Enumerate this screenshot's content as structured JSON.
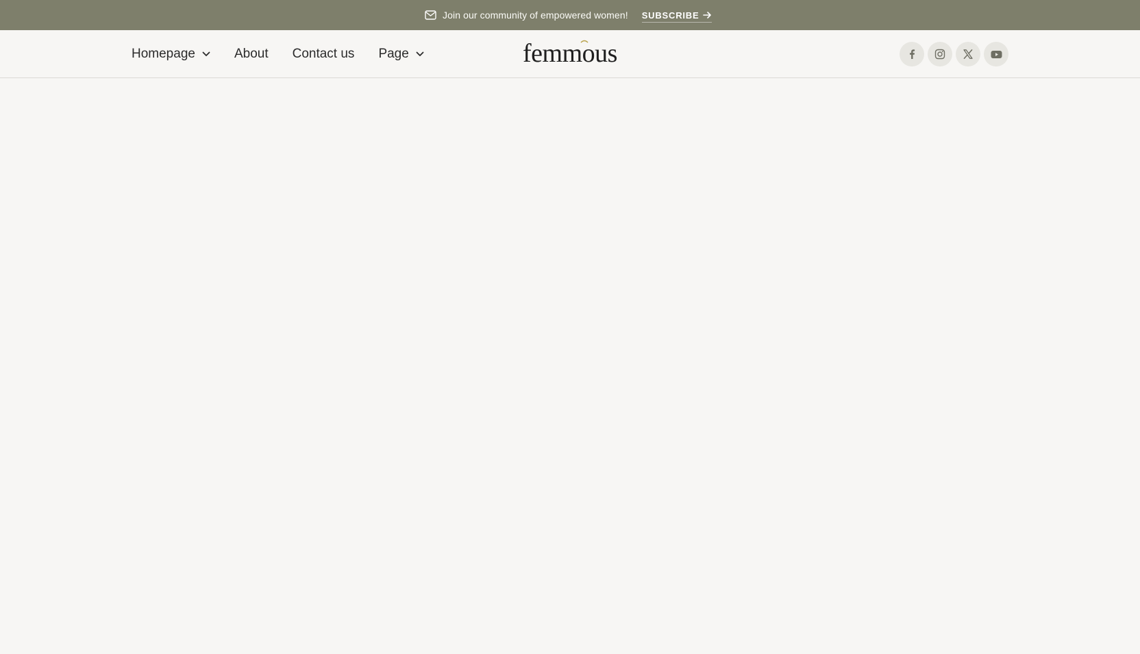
{
  "announcement": {
    "text": "Join our community of empowered women!",
    "cta_label": "SUBSCRIBE",
    "icon": "mail-icon",
    "cta_icon": "arrow-right-icon"
  },
  "nav": {
    "items": [
      {
        "label": "Homepage",
        "has_dropdown": true
      },
      {
        "label": "About",
        "has_dropdown": false
      },
      {
        "label": "Contact us",
        "has_dropdown": false
      },
      {
        "label": "Page",
        "has_dropdown": true
      }
    ]
  },
  "logo": {
    "text": "femmous"
  },
  "social": {
    "icons": [
      "facebook-icon",
      "instagram-icon",
      "x-twitter-icon",
      "youtube-icon"
    ]
  },
  "colors": {
    "topbar_bg": "#7e7f6b",
    "page_bg": "#f7f6f4",
    "text": "#2b2b2b",
    "social_bg": "#e7e6e1",
    "accent": "#b8a24a"
  }
}
